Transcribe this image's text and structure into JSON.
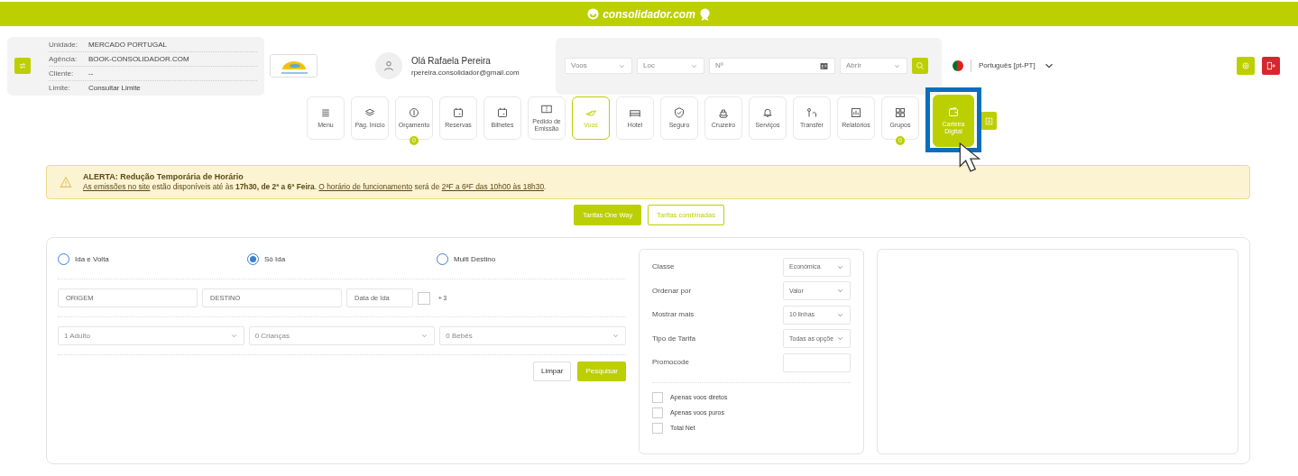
{
  "header": {
    "logo_text": "consolidador.com"
  },
  "account": {
    "rows": [
      {
        "label": "Unidade:",
        "value": "MERCADO PORTUGAL"
      },
      {
        "label": "Agência:",
        "value": "BOOK-CONSOLIDADOR.COM"
      },
      {
        "label": "Cliente:",
        "value": "--"
      },
      {
        "label": "Limite:",
        "value": "Consultar Limite"
      }
    ]
  },
  "user": {
    "greeting": "Olá Rafaela Pereira",
    "email": "rpereira.consolidador@gmail.com"
  },
  "quick_search": {
    "product": "Voos",
    "locator": "Loc",
    "number_placeholder": "Nº",
    "action": "Abrir"
  },
  "language": {
    "label": "Português [pt-PT]"
  },
  "nav": {
    "items": [
      {
        "label": "Menu",
        "selected": false,
        "highlighted": false
      },
      {
        "label": "Pág. Início",
        "selected": false,
        "highlighted": false
      },
      {
        "label": "Orçamento",
        "selected": false,
        "highlighted": false,
        "badge": "0"
      },
      {
        "label": "Reservas",
        "selected": false,
        "highlighted": false
      },
      {
        "label": "Bilhetes",
        "selected": false,
        "highlighted": false
      },
      {
        "label": "Pedido de Emissão",
        "selected": false,
        "highlighted": false
      },
      {
        "label": "Voos",
        "selected": true,
        "highlighted": false
      },
      {
        "label": "Hotel",
        "selected": false,
        "highlighted": false
      },
      {
        "label": "Seguro",
        "selected": false,
        "highlighted": false
      },
      {
        "label": "Cruzeiro",
        "selected": false,
        "highlighted": false
      },
      {
        "label": "Serviços",
        "selected": false,
        "highlighted": false
      },
      {
        "label": "Transfer",
        "selected": false,
        "highlighted": false
      },
      {
        "label": "Relatórios",
        "selected": false,
        "highlighted": false
      },
      {
        "label": "Grupos",
        "selected": false,
        "highlighted": false,
        "badge": "0"
      },
      {
        "label": "Carteira Digital",
        "selected": false,
        "highlighted": true
      }
    ]
  },
  "alert": {
    "title": "ALERTA: Redução Temporária de Horário",
    "segments": [
      {
        "kind": "link",
        "text": "As emissões no site"
      },
      {
        "kind": "text",
        "text": " estão disponíveis até às "
      },
      {
        "kind": "bold",
        "text": "17h30, de 2ª a 6ª Feira"
      },
      {
        "kind": "text",
        "text": ". "
      },
      {
        "kind": "link",
        "text": "O horário de funcionamento"
      },
      {
        "kind": "text",
        "text": " será de "
      },
      {
        "kind": "link",
        "text": "2ªF a 6ªF das 10h00 às 18h30"
      },
      {
        "kind": "text",
        "text": "."
      }
    ]
  },
  "fare_tabs": [
    {
      "label": "Tarifas One Way",
      "selected": true
    },
    {
      "label": "Tarifas combinadas",
      "selected": false
    }
  ],
  "trip_types": [
    {
      "label": "Ida e Volta",
      "selected": false
    },
    {
      "label": "Só Ida",
      "selected": true
    },
    {
      "label": "Multi Destino",
      "selected": false
    }
  ],
  "route": {
    "origin_placeholder": "ORIGEM",
    "destination_placeholder": "DESTINO",
    "date_placeholder": "Data de Ida",
    "flex_label": "+ 3",
    "flex_checked": false
  },
  "passengers": [
    "1 Adulto",
    "0 Crianças",
    "0 Bebés"
  ],
  "actions": [
    "Limpar",
    "Pesquisar"
  ],
  "filters": [
    {
      "label": "Classe",
      "kind": "select",
      "value": "Económica"
    },
    {
      "label": "Ordenar por",
      "kind": "select",
      "value": "Valor"
    },
    {
      "label": "Mostrar mais",
      "kind": "select",
      "value": "10 linhas"
    },
    {
      "label": "Tipo de Tarifa",
      "kind": "select",
      "value": "Todas as opçõe"
    },
    {
      "label": "Promocode",
      "kind": "input"
    }
  ],
  "options": [
    {
      "label": "Apenas voos diretos",
      "checked": false
    },
    {
      "label": "Apenas voos puros",
      "checked": false
    },
    {
      "label": "Total Net",
      "checked": false
    }
  ]
}
